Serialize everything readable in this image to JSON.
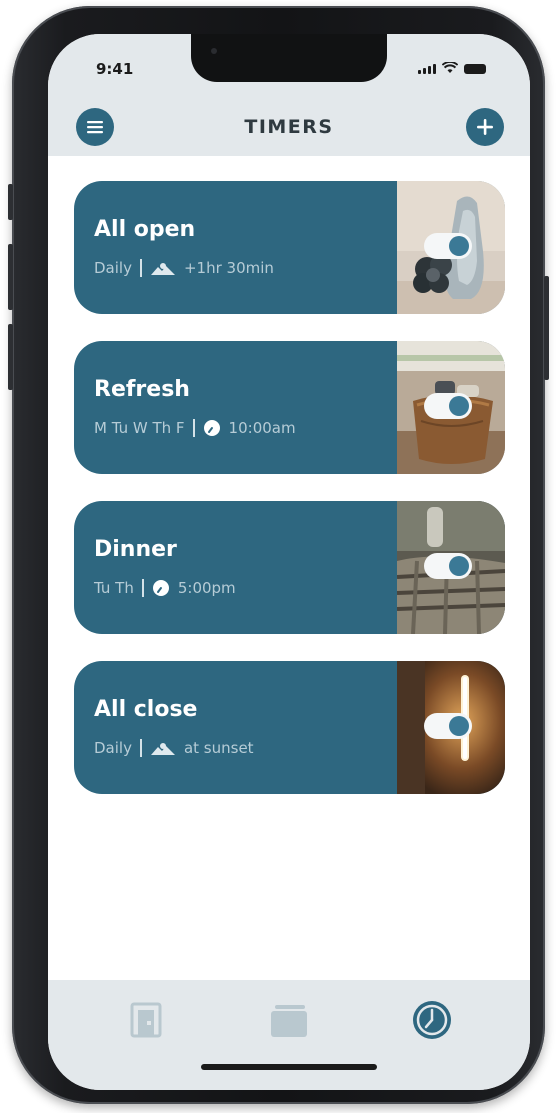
{
  "status": {
    "time": "9:41"
  },
  "header": {
    "title": "TIMERS",
    "menu_icon": "hamburger-menu-icon",
    "add_icon": "plus-icon"
  },
  "timers": [
    {
      "name": "All open",
      "days": "Daily",
      "trigger_icon": "sunrise-icon",
      "when": "+1hr 30min",
      "enabled": true
    },
    {
      "name": "Refresh",
      "days": "M Tu W Th F",
      "trigger_icon": "clock-icon",
      "when": "10:00am",
      "enabled": true
    },
    {
      "name": "Dinner",
      "days": "Tu Th",
      "trigger_icon": "clock-icon",
      "when": "5:00pm",
      "enabled": true
    },
    {
      "name": "All close",
      "days": "Daily",
      "trigger_icon": "sunset-icon",
      "when": "at sunset",
      "enabled": true
    }
  ],
  "tabbar": {
    "tabs": [
      {
        "icon": "room-door-icon",
        "active": false
      },
      {
        "icon": "scene-cards-icon",
        "active": false
      },
      {
        "icon": "clock-icon",
        "active": true
      }
    ]
  },
  "colors": {
    "accent": "#2e6780",
    "header_bg": "#e3e8eb",
    "meta_text": "#b6ccd6",
    "inactive_icon": "#b9c8cf"
  }
}
